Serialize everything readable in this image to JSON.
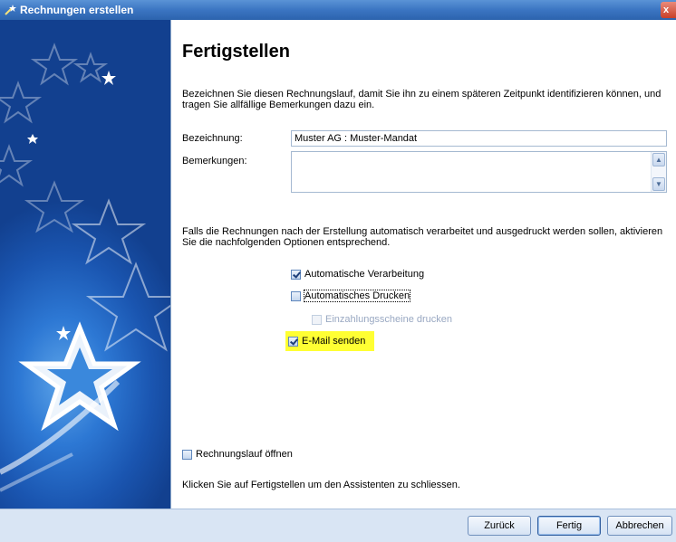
{
  "window": {
    "title": "Rechnungen erstellen",
    "close_glyph": "x"
  },
  "page": {
    "heading": "Fertigstellen",
    "intro": "Bezeichnen Sie diesen Rechnungslauf, damit Sie ihn zu einem späteren Zeitpunkt identifizieren können, und tragen Sie allfällige Bemerkungen dazu ein."
  },
  "form": {
    "bezeichnung_label": "Bezeichnung:",
    "bezeichnung_value": "Muster AG : Muster-Mandat",
    "bemerkungen_label": "Bemerkungen:",
    "bemerkungen_value": ""
  },
  "options": {
    "text": "Falls die Rechnungen nach der Erstellung automatisch verarbeitet und ausgedruckt werden sollen, aktivieren Sie die nachfolgenden Optionen entsprechend.",
    "auto_verarbeitung": {
      "label": "Automatische Verarbeitung",
      "checked": true
    },
    "auto_drucken": {
      "label": "Automatisches Drucken",
      "checked": false
    },
    "einzahlungsscheine": {
      "label": "Einzahlungsscheine drucken",
      "checked": false,
      "enabled": false
    },
    "email_senden": {
      "label": "E-Mail senden",
      "checked": true
    }
  },
  "rechnungslauf_oeffnen": {
    "label": "Rechnungslauf öffnen",
    "checked": false
  },
  "finish_text": "Klicken Sie auf Fertigstellen um den Assistenten zu schliessen.",
  "buttons": {
    "back": "Zurück",
    "finish": "Fertig",
    "cancel": "Abbrechen"
  },
  "colors": {
    "titlebar": "#3b75c2",
    "sidebar": "#2d78d4",
    "highlight": "#ffff33",
    "footer": "#d9e5f4"
  }
}
